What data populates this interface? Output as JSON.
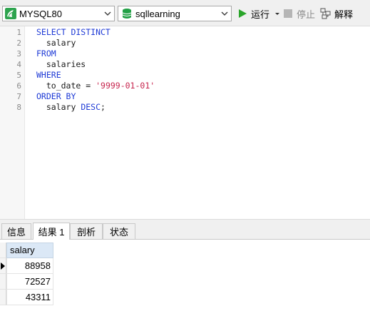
{
  "toolbar": {
    "connection": "MYSQL80",
    "database": "sqllearning",
    "run_label": "运行",
    "stop_label": "停止",
    "explain_label": "解释"
  },
  "editor": {
    "line_numbers": [
      "1",
      "2",
      "3",
      "4",
      "5",
      "6",
      "7",
      "8"
    ],
    "lines": [
      [
        {
          "t": "SELECT DISTINCT",
          "c": "kw"
        }
      ],
      [
        {
          "t": "  salary",
          "c": "plain"
        }
      ],
      [
        {
          "t": "FROM",
          "c": "kw"
        }
      ],
      [
        {
          "t": "  salaries",
          "c": "plain"
        }
      ],
      [
        {
          "t": "WHERE",
          "c": "kw"
        }
      ],
      [
        {
          "t": "  to_date = ",
          "c": "plain"
        },
        {
          "t": "'9999-01-01'",
          "c": "str"
        }
      ],
      [
        {
          "t": "ORDER BY",
          "c": "kw"
        }
      ],
      [
        {
          "t": "  salary ",
          "c": "plain"
        },
        {
          "t": "DESC",
          "c": "kw"
        },
        {
          "t": ";",
          "c": "plain"
        }
      ]
    ]
  },
  "tabs": {
    "info": "信息",
    "result": "结果 1",
    "profile": "剖析",
    "status": "状态"
  },
  "results": {
    "columns": [
      "salary"
    ],
    "rows": [
      "88958",
      "72527",
      "43311"
    ]
  },
  "colors": {
    "keyword": "#1f3bd6",
    "string": "#c7254e",
    "run_green": "#2aa52a",
    "db_green": "#22a046",
    "header_bg": "#dbe8f6"
  }
}
